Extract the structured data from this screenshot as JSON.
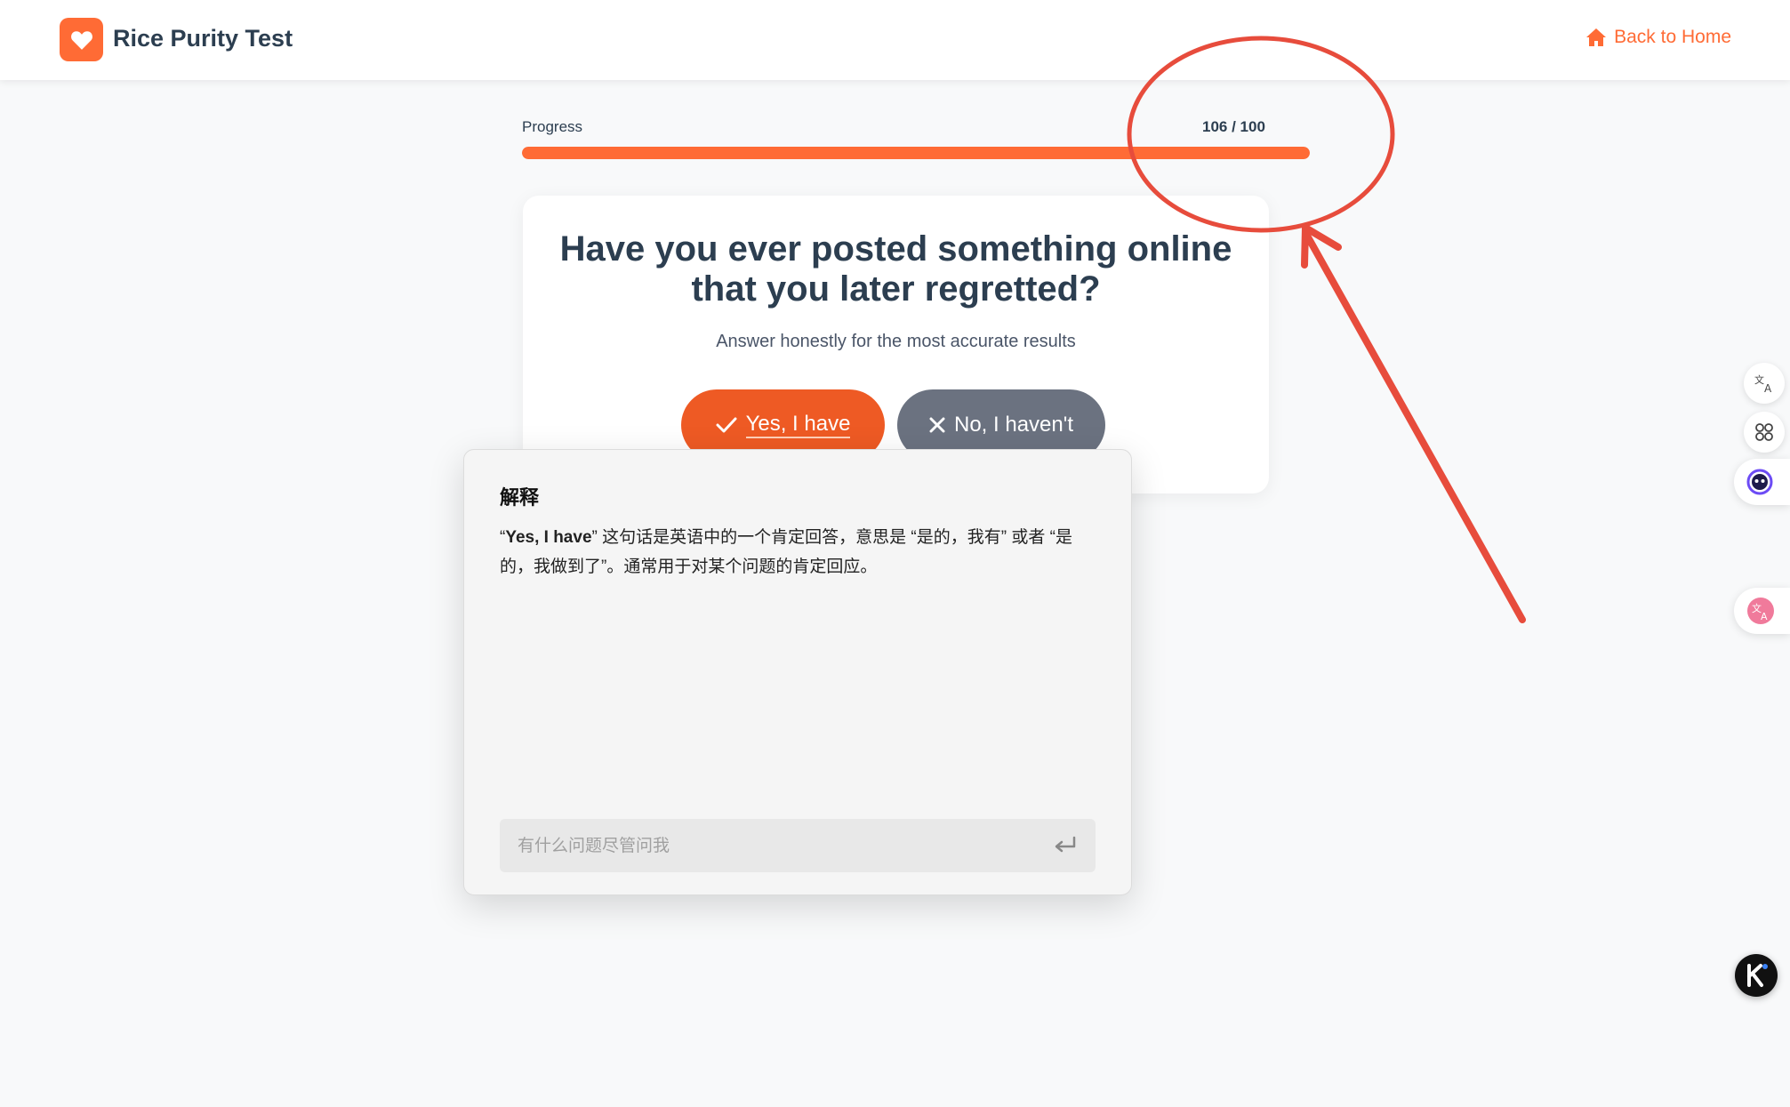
{
  "header": {
    "brand": "Rice Purity Test",
    "logo_icon": "heart-icon",
    "back_home_label": "Back to Home",
    "back_home_icon": "home-icon"
  },
  "progress": {
    "label": "Progress",
    "count_text": "106 / 100",
    "fill_fraction": 1.0
  },
  "question": {
    "text": "Have you ever posted something online that you later regretted?",
    "subtitle": "Answer honestly for the most accurate results",
    "yes_label": "Yes, I have",
    "no_label": "No, I haven't"
  },
  "popup": {
    "title": "解释",
    "body_term": "Yes, I have",
    "body_open_quote": "“",
    "body_rest": "” 这句话是英语中的一个肯定回答，意思是 “是的，我有” 或者 “是的，我做到了”。通常用于对某个问题的肯定回应。",
    "ask_placeholder": "有什么问题尽管问我",
    "enter_icon": "enter-icon"
  },
  "side_tools": [
    "translate-icon",
    "apps-icon",
    "assistant-face-icon",
    "translate-pink-icon",
    "k-app-icon"
  ],
  "colors": {
    "accent": "#ff6b35",
    "yes_button": "#ee5a24",
    "no_button": "#6b7280",
    "heading": "#2c3e50",
    "annotation": "#e74c3c"
  }
}
